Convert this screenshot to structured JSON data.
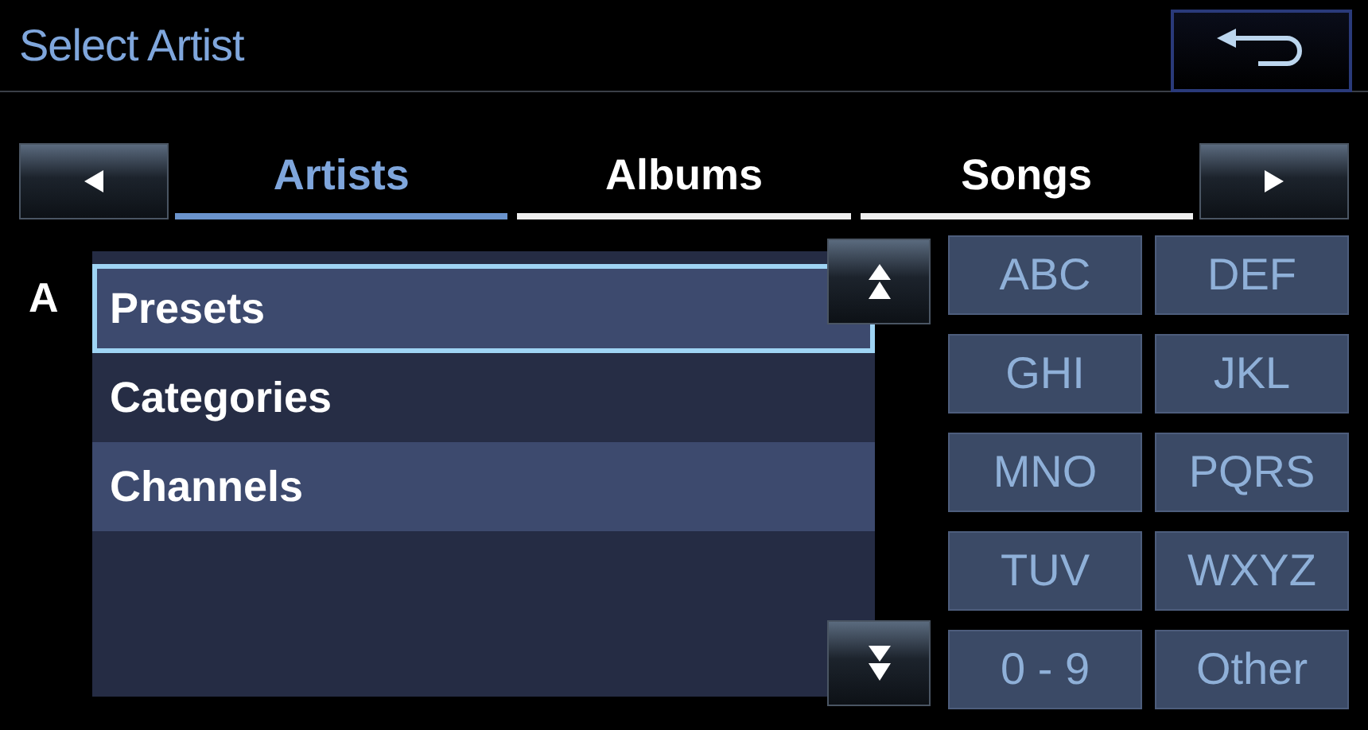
{
  "header": {
    "title": "Select Artist"
  },
  "tabs": [
    {
      "label": "Artists",
      "selected": true
    },
    {
      "label": "Albums",
      "selected": false
    },
    {
      "label": "Songs",
      "selected": false
    }
  ],
  "list": {
    "index_letter": "A",
    "items": [
      {
        "label": "Presets",
        "focused": true,
        "highlighted": true
      },
      {
        "label": "Categories",
        "focused": false,
        "highlighted": false
      },
      {
        "label": "Channels",
        "focused": false,
        "highlighted": true
      }
    ]
  },
  "keys": [
    "ABC",
    "DEF",
    "GHI",
    "JKL",
    "MNO",
    "PQRS",
    "TUV",
    "WXYZ",
    "0 - 9",
    "Other"
  ]
}
